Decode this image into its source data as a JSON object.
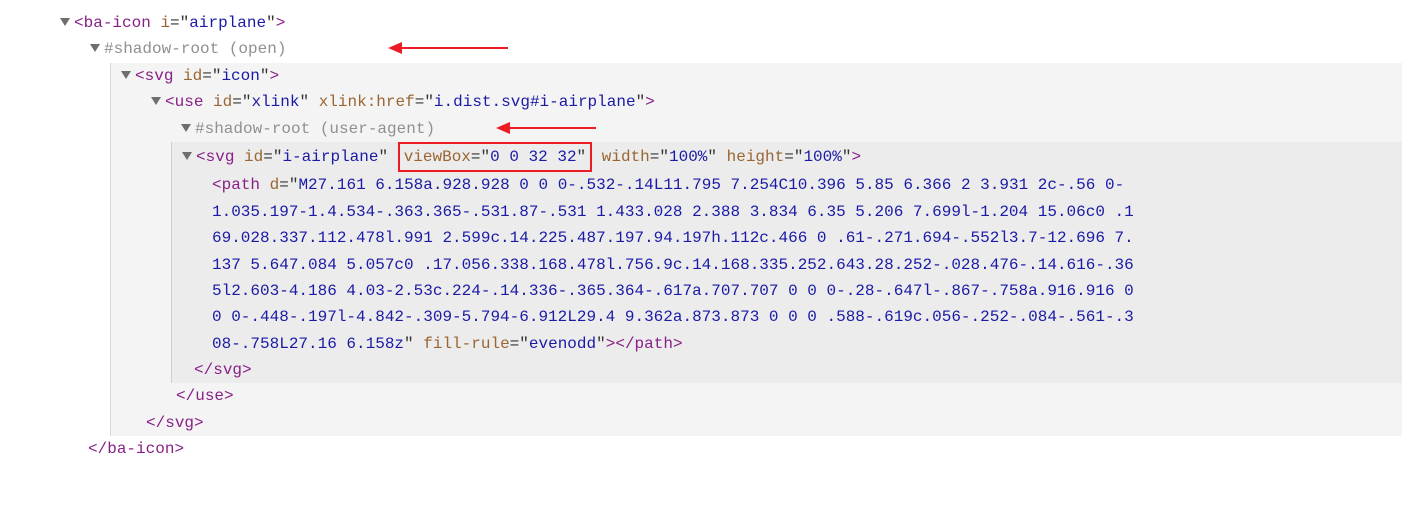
{
  "line1": {
    "tag": "ba-icon",
    "attr": "i",
    "val": "airplane"
  },
  "line2": {
    "text": "#shadow-root (open)"
  },
  "line3": {
    "tag": "svg",
    "attr": "id",
    "val": "icon"
  },
  "line4": {
    "tag": "use",
    "attr1": "id",
    "val1": "xlink",
    "attr2": "xlink:href",
    "val2": "i.dist.svg#i-airplane"
  },
  "line5": {
    "text": "#shadow-root (user-agent)"
  },
  "line6": {
    "tag": "svg",
    "attr1": "id",
    "val1": "i-airplane",
    "attr2": "viewBox",
    "val2": "0 0 32 32",
    "attr3": "width",
    "val3": "100%",
    "attr4": "height",
    "val4": "100%"
  },
  "line7": {
    "tag_open": "path",
    "attr1": "d",
    "val1": "M27.161 6.158a.928.928 0 0 0-.532-.14L11.795 7.254C10.396 5.85 6.366 2 3.931 2c-.56 0-1.035.197-1.4.534-.363.365-.531.87-.531 1.433.028 2.388 3.834 6.35 5.206 7.699l-1.204 15.06c0 .169.028.337.112.478l.991 2.599c.14.225.487.197.94.197h.112c.466 0 .61-.271.694-.552l3.7-12.696 7.137 5.647.084 5.057c0 .17.056.338.168.478l.756.9c.14.168.335.252.643.28.252-.028.476-.14.616-.365l2.603-4.186 4.03-2.53c.224-.14.336-.365.364-.617a.707.707 0 0 0-.28-.647l-.867-.758a.916.916 0 0 0-.448-.197l-4.842-.309-5.794-6.912L29.4 9.362a.873.873 0 0 0 .588-.619c.056-.252-.084-.561-.308-.758L27.16 6.158z",
    "attr2": "fill-rule",
    "val2": "evenodd",
    "tag_close": "path"
  },
  "close_svg_inner": "svg",
  "close_use": "use",
  "close_svg_outer": "svg",
  "close_ba": "ba-icon",
  "punct": {
    "lt": "<",
    "gt": ">",
    "sl": "/",
    "eq": "=",
    "q": "\""
  }
}
